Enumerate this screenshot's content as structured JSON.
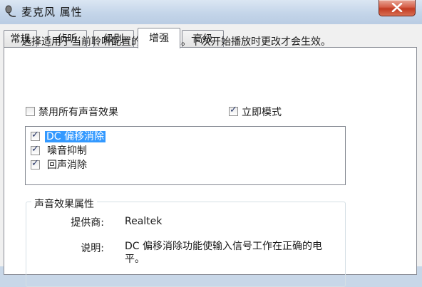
{
  "window": {
    "title": "麦克风 属性",
    "icon": "microphone-icon"
  },
  "tabs": [
    {
      "label": "常规",
      "active": false
    },
    {
      "label": "侦听",
      "active": false
    },
    {
      "label": "级别",
      "active": false
    },
    {
      "label": "增强",
      "active": true
    },
    {
      "label": "高级",
      "active": false
    }
  ],
  "enhancements": {
    "description": "选择适用于当前聆听配置的声音效果。下次开始播放时更改才会生效。",
    "disable_all": {
      "label": "禁用所有声音效果",
      "checked": false
    },
    "immediate_mode": {
      "label": "立即模式",
      "checked": true
    },
    "effects": [
      {
        "label": "DC 偏移消除",
        "checked": true,
        "selected": true
      },
      {
        "label": "噪音抑制",
        "checked": true,
        "selected": false
      },
      {
        "label": "回声消除",
        "checked": true,
        "selected": false
      }
    ]
  },
  "properties": {
    "group_title": "声音效果属性",
    "provider_label": "提供商:",
    "provider_value": "Realtek",
    "description_label": "说明:",
    "description_value": "DC 偏移消除功能使输入信号工作在正确的电平。"
  },
  "colors": {
    "selection": "#3399ff",
    "close_button": "#c23b22"
  }
}
